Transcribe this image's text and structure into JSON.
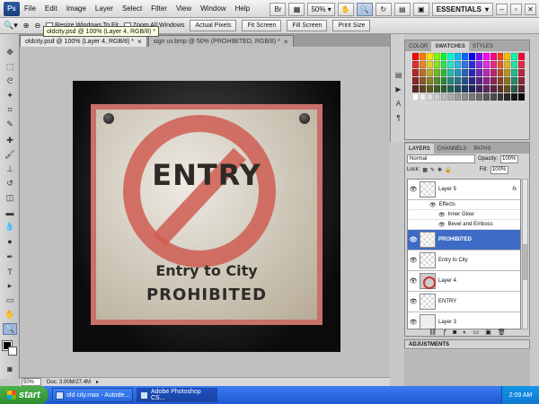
{
  "menubar": {
    "logo": "Ps",
    "items": [
      "File",
      "Edit",
      "Image",
      "Layer",
      "Select",
      "Filter",
      "View",
      "Window",
      "Help"
    ],
    "zoom": "50%",
    "workspace": "ESSENTIALS"
  },
  "options": {
    "resize_windows": "Resize Windows To Fit",
    "zoom_all": "Zoom All Windows",
    "buttons": [
      "Actual Pixels",
      "Fit Screen",
      "Fill Screen",
      "Print Size"
    ]
  },
  "tooltip": "oldcity.psd @ 100% (Layer 4, RGB/8) *",
  "tabs": [
    {
      "label": "oldcity.psd @ 100% (Layer 4, RGB/8) *",
      "active": true
    },
    {
      "label": "sign uv.bmp @ 50% (PROHIBITED, RGB/8) *",
      "active": false
    }
  ],
  "canvas": {
    "sign_big": "ENTRY",
    "sign_line1": "Entry to City",
    "sign_line2": "PROHIBITED"
  },
  "status": {
    "zoom": "50%",
    "doc": "Doc: 3.00M/27.4M"
  },
  "swatch_panel": {
    "tabs": [
      "COLOR",
      "SWATCHES",
      "STYLES"
    ],
    "active_tab": "SWATCHES"
  },
  "layers_panel": {
    "tabs": [
      "LAYERS",
      "CHANNELS",
      "PATHS"
    ],
    "blend_mode": "Normal",
    "opacity_label": "Opacity:",
    "opacity": "100%",
    "lock_label": "Lock:",
    "fill_label": "Fill:",
    "fill": "100%",
    "layers": [
      {
        "name": "Layer 5",
        "fx": "fx"
      },
      {
        "name": "PROHIBITED",
        "selected": true
      },
      {
        "name": "Entry to City"
      },
      {
        "name": "Layer 4"
      },
      {
        "name": "ENTRY"
      },
      {
        "name": "Layer 3"
      }
    ],
    "effects_label": "Effects",
    "effects": [
      "Inner Glow",
      "Bevel and Emboss"
    ]
  },
  "adjustments": "ADJUSTMENTS",
  "taskbar": {
    "start": "start",
    "tasks": [
      "old city.max - Autode...",
      "Adobe Photoshop CS..."
    ],
    "clock": "2:09 AM"
  },
  "colors": {
    "selection": "#3e6bc5",
    "sign_red": "#c9706a",
    "taskbar": "#1f59d1"
  }
}
